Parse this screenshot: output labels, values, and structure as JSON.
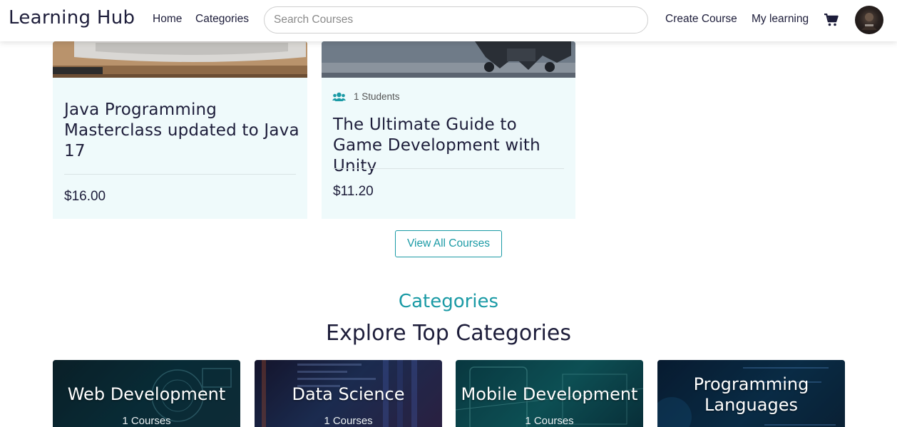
{
  "navbar": {
    "brand": "Learning Hub",
    "links": {
      "home": "Home",
      "categories": "Categories",
      "create_course": "Create Course",
      "my_learning": "My learning"
    },
    "search_placeholder": "Search Courses",
    "icons": {
      "cart": "shopping-cart-icon",
      "avatar": "user-avatar"
    }
  },
  "courses": [
    {
      "title": "Java Programming Masterclass updated to Java 17",
      "price": "$16.00"
    },
    {
      "students": "1 Students",
      "title": "The Ultimate Guide to Game Development with Unity",
      "price": "$11.20"
    }
  ],
  "view_all_label": "View All Courses",
  "categories_section": {
    "label": "Categories",
    "heading": "Explore Top Categories",
    "items": [
      {
        "name": "Web Development",
        "count": "1 Courses"
      },
      {
        "name": "Data Science",
        "count": "1 Courses"
      },
      {
        "name": "Mobile Development",
        "count": "1 Courses"
      },
      {
        "name": "Programming Languages",
        "count": ""
      }
    ]
  },
  "colors": {
    "accent": "#1a9aa5",
    "text": "#1d1d3a",
    "card_bg": "#effafb"
  }
}
